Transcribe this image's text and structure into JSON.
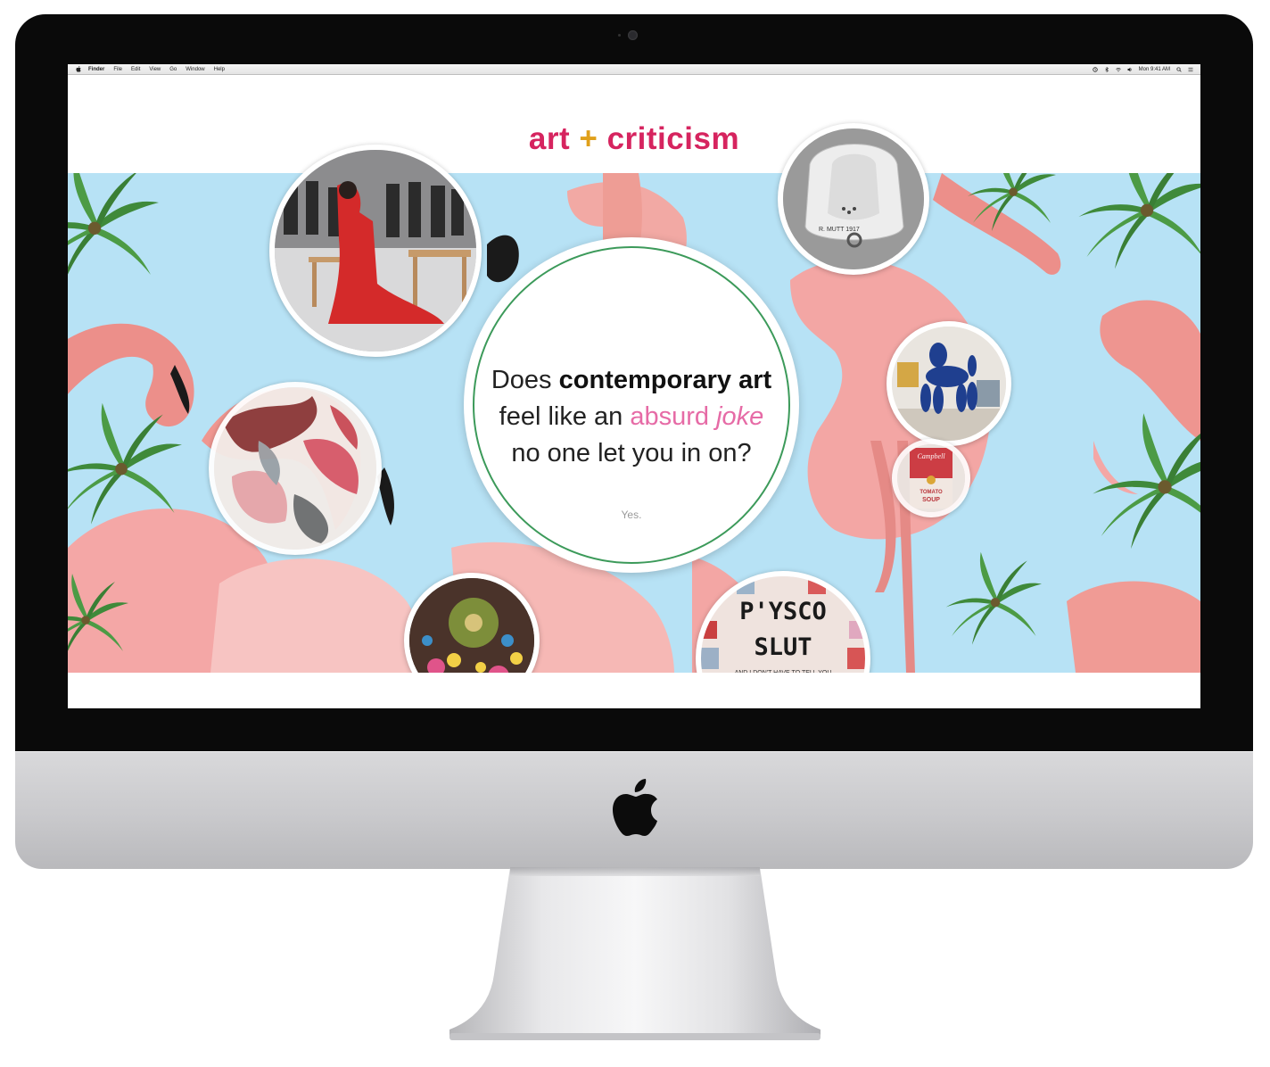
{
  "os_menubar": {
    "app": "Finder",
    "menus": [
      "File",
      "Edit",
      "View",
      "Go",
      "Window",
      "Help"
    ],
    "clock": "Mon 9:41 AM"
  },
  "site": {
    "title_left": "art",
    "title_plus": "+",
    "title_right": "criticism"
  },
  "hero": {
    "question_line1_a": "Does ",
    "question_line1_b": "contemporary art",
    "question_line2_a": "feel like an ",
    "question_line2_b": "absurd ",
    "question_line2_c": "joke",
    "question_line3": "no one let you in on?",
    "answer_link": "Yes."
  },
  "artworks": {
    "soup_brand": "Campbell",
    "soup_line1": "TOMATO",
    "soup_line2": "SOUP",
    "sign_line1": "P'YSCO",
    "sign_line2": "SLUT",
    "sign_small": "AND I DON'T HAVE TO TELL YOU",
    "urinal_signature": "R. MUTT 1917"
  },
  "colors": {
    "title_pink": "#d6245f",
    "plus_gold": "#e0a01a",
    "hero_sky": "#b7e2f5",
    "ring_green": "#3c9a5a",
    "accent_pink": "#e66ba6"
  }
}
